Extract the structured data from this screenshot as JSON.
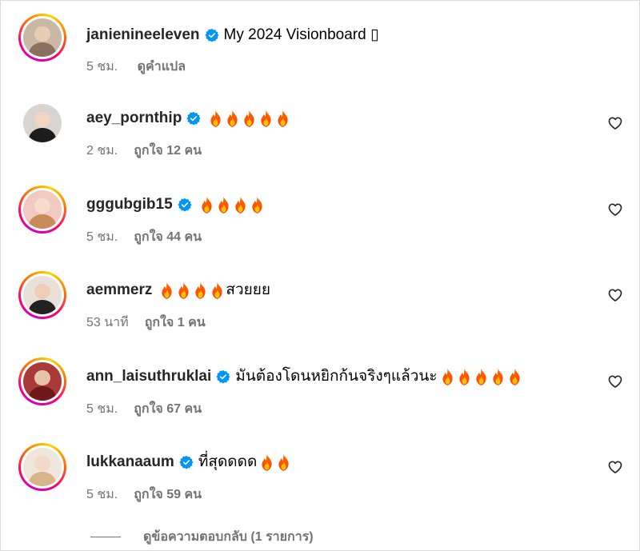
{
  "caption": {
    "username": "janienineeleven",
    "text": "My 2024 Visionboard ▯",
    "time": "5 ชม.",
    "translate_label": "ดูคำแปล"
  },
  "comments": [
    {
      "username": "aey_pornthip",
      "verified": true,
      "text": "",
      "fires": 5,
      "time": "2 ชม.",
      "likes": "ถูกใจ 12 คน"
    },
    {
      "username": "gggubgib15",
      "verified": true,
      "text": "",
      "fires": 4,
      "time": "5 ชม.",
      "likes": "ถูกใจ 44 คน"
    },
    {
      "username": "aemmerz",
      "verified": false,
      "text": "สวยยย",
      "fires": 4,
      "time": "53 นาที",
      "likes": "ถูกใจ 1 คน"
    },
    {
      "username": "ann_laisuthruklai",
      "verified": true,
      "text": "มันต้องโดนหยิกก้นจริงๆแล้วนะ",
      "fires": 5,
      "time": "5 ชม.",
      "likes": "ถูกใจ 67 คน"
    },
    {
      "username": "lukkanaaum",
      "verified": true,
      "text": "ที่สุดดดด",
      "fires": 2,
      "time": "5 ชม.",
      "likes": "ถูกใจ 59 คน"
    }
  ],
  "view_replies_label": "ดูข้อความตอบกลับ (1 รายการ)",
  "icons": {
    "verified": "verified-badge-icon",
    "fire": "fire-emoji-icon",
    "heart": "heart-outline-icon"
  },
  "colors": {
    "verified": "#0095f6",
    "secondary_text": "#737373"
  }
}
